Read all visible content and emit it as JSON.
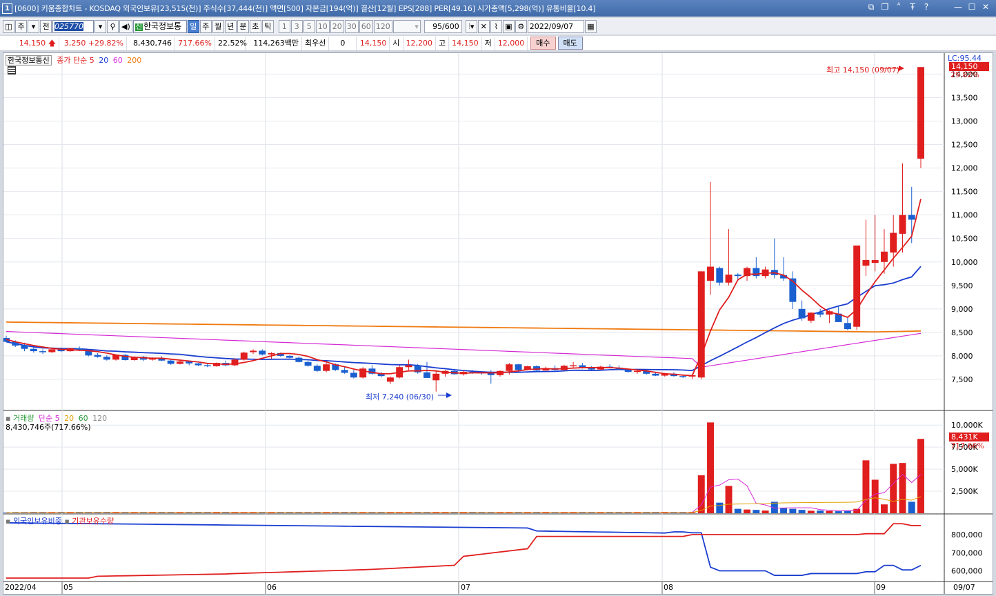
{
  "window": {
    "index": "1",
    "title": "[0600] 키움종합차트 - KOSDAQ 외국인보유[23,515(천)] 주식수[37,444(천)] 액면[500] 자본금[194(억)] 결산[12월] EPS[288] PER[49.16] 시가총액[5,298(억)] 유통비율[10.4]"
  },
  "toolbar": {
    "period_btn": "주",
    "prev_btn": "전",
    "code": "025770",
    "stock_name_badge": "신",
    "stock_name": "한국정보통",
    "periods": [
      "일",
      "주",
      "월",
      "년",
      "분",
      "초",
      "틱"
    ],
    "active_period": "일",
    "intervals": [
      "1",
      "3",
      "5",
      "10",
      "20",
      "30",
      "60",
      "120"
    ],
    "count": "95/600",
    "date": "2022/09/07"
  },
  "pricebar": {
    "price": "14,150",
    "change": "3,250",
    "change_pct": "+29.82%",
    "volume": "8,430,746",
    "vol_ratio": "717.66%",
    "turnover": "22.52%",
    "amount": "114,263백만",
    "pref_label": "최우선",
    "pref_value": "0",
    "best_price": "14,150",
    "open_label": "시",
    "open": "12,200",
    "high_label": "고",
    "high": "14,150",
    "low_label": "저",
    "low": "12,000",
    "buy": "매수",
    "sell": "매도"
  },
  "price_panel": {
    "stock_label": "한국정보통신",
    "ma_label": "종가 단순",
    "ma_periods": [
      "5",
      "20",
      "60",
      "200"
    ],
    "ma_colors": [
      "#e01e1e",
      "#1a3dd0",
      "#d62ad6",
      "#f07a10"
    ],
    "lc_label": "LC:95.44",
    "current_tag": "14,150",
    "current_pct": "29.82%",
    "high_note": "최고 14,150 (09/07)",
    "low_note": "최저 7,240 (06/30)",
    "y_ticks": [
      "14,000",
      "13,500",
      "13,000",
      "12,500",
      "12,000",
      "11,500",
      "11,000",
      "10,500",
      "10,000",
      "9,500",
      "9,000",
      "8,500",
      "8,000",
      "7,500"
    ]
  },
  "volume_panel": {
    "label": "거래량",
    "ma_label": "단순",
    "ma_periods": [
      "5",
      "20",
      "60",
      "120"
    ],
    "ma_colors": [
      "#d62ad6",
      "#e0a000",
      "#2a9a3a",
      "#888888"
    ],
    "info": "8,430,746주(717.66%)",
    "current_tag": "8,431K",
    "current_pct": "717.66%",
    "y_ticks": [
      "10,000K",
      "7,500K",
      "5,000K",
      "2,500K"
    ]
  },
  "holding_panel": {
    "foreign_label": "외국인보유비중",
    "inst_label": "기관보유수량",
    "y_ticks": [
      "800,000",
      "700,000",
      "600,000"
    ]
  },
  "x_axis": {
    "labels": [
      "2022/04",
      "05",
      "06",
      "07",
      "08",
      "09"
    ],
    "end_label": "09/07"
  },
  "chart_data": {
    "type": "candlestick",
    "dates_first": "2022/04",
    "dates_last": "09/07",
    "ylim": [
      7000,
      14300
    ],
    "candles": [
      [
        8380,
        8430,
        8290,
        8300
      ],
      [
        8300,
        8330,
        8190,
        8220
      ],
      [
        8230,
        8280,
        8100,
        8150
      ],
      [
        8150,
        8200,
        8070,
        8100
      ],
      [
        8100,
        8140,
        8040,
        8080
      ],
      [
        8080,
        8160,
        8060,
        8140
      ],
      [
        8150,
        8180,
        8080,
        8100
      ],
      [
        8100,
        8170,
        8090,
        8160
      ],
      [
        8160,
        8200,
        8100,
        8110
      ],
      [
        8120,
        8140,
        7990,
        8010
      ],
      [
        8020,
        8060,
        7960,
        7980
      ],
      [
        7980,
        8010,
        7900,
        7920
      ],
      [
        7920,
        8030,
        7900,
        8020
      ],
      [
        8020,
        8040,
        7900,
        7910
      ],
      [
        7910,
        7990,
        7900,
        7980
      ],
      [
        7980,
        8000,
        7890,
        7920
      ],
      [
        7920,
        7970,
        7900,
        7960
      ],
      [
        7950,
        7990,
        7890,
        7900
      ],
      [
        7900,
        7920,
        7810,
        7830
      ],
      [
        7830,
        7900,
        7820,
        7880
      ],
      [
        7880,
        7900,
        7800,
        7840
      ],
      [
        7840,
        7850,
        7780,
        7800
      ],
      [
        7800,
        7830,
        7760,
        7780
      ],
      [
        7780,
        7860,
        7770,
        7850
      ],
      [
        7850,
        7900,
        7780,
        7800
      ],
      [
        7800,
        7950,
        7780,
        7920
      ],
      [
        7920,
        8090,
        7900,
        8070
      ],
      [
        8080,
        8140,
        8040,
        8110
      ],
      [
        8110,
        8140,
        8010,
        8030
      ],
      [
        8030,
        8080,
        7940,
        8060
      ],
      [
        8060,
        8070,
        7980,
        8000
      ],
      [
        8000,
        8020,
        7950,
        7960
      ],
      [
        7960,
        7990,
        7860,
        7870
      ],
      [
        7870,
        7900,
        7770,
        7790
      ],
      [
        7790,
        7820,
        7660,
        7680
      ],
      [
        7680,
        7850,
        7650,
        7820
      ],
      [
        7820,
        7840,
        7680,
        7700
      ],
      [
        7700,
        7760,
        7620,
        7640
      ],
      [
        7640,
        7700,
        7520,
        7540
      ],
      [
        7540,
        7760,
        7520,
        7730
      ],
      [
        7730,
        7800,
        7600,
        7620
      ],
      [
        7620,
        7660,
        7540,
        7570
      ],
      [
        7450,
        7560,
        7400,
        7540
      ],
      [
        7540,
        7800,
        7520,
        7760
      ],
      [
        7760,
        7920,
        7700,
        7800
      ],
      [
        7800,
        7830,
        7620,
        7650
      ],
      [
        7650,
        7870,
        7620,
        7530
      ],
      [
        7480,
        7680,
        7240,
        7620
      ],
      [
        7620,
        7700,
        7560,
        7680
      ],
      [
        7680,
        7720,
        7600,
        7610
      ],
      [
        7610,
        7690,
        7580,
        7660
      ],
      [
        7660,
        7700,
        7620,
        7650
      ],
      [
        7650,
        7660,
        7600,
        7630
      ],
      [
        7640,
        7700,
        7410,
        7590
      ],
      [
        7590,
        7690,
        7560,
        7680
      ],
      [
        7680,
        7850,
        7600,
        7820
      ],
      [
        7820,
        7830,
        7650,
        7700
      ],
      [
        7700,
        7790,
        7690,
        7780
      ],
      [
        7780,
        7800,
        7660,
        7690
      ],
      [
        7690,
        7770,
        7680,
        7740
      ],
      [
        7740,
        7800,
        7680,
        7700
      ],
      [
        7700,
        7810,
        7690,
        7790
      ],
      [
        7790,
        7870,
        7740,
        7800
      ],
      [
        7800,
        7850,
        7730,
        7740
      ],
      [
        7740,
        7780,
        7690,
        7710
      ],
      [
        7710,
        7790,
        7700,
        7770
      ],
      [
        7770,
        7820,
        7730,
        7750
      ],
      [
        7750,
        7800,
        7700,
        7710
      ],
      [
        7710,
        7720,
        7640,
        7660
      ],
      [
        7660,
        7700,
        7620,
        7680
      ],
      [
        7680,
        7700,
        7600,
        7620
      ],
      [
        7620,
        7640,
        7570,
        7580
      ],
      [
        7580,
        7640,
        7560,
        7620
      ],
      [
        7620,
        7650,
        7560,
        7570
      ],
      [
        7570,
        7600,
        7530,
        7560
      ],
      [
        7560,
        7600,
        7510,
        7590
      ],
      [
        7540,
        9800,
        7500,
        9800
      ],
      [
        9600,
        11700,
        9300,
        9900
      ],
      [
        9870,
        9900,
        9500,
        9560
      ],
      [
        9560,
        10700,
        9500,
        9730
      ],
      [
        9730,
        9760,
        9600,
        9700
      ],
      [
        9700,
        9900,
        9600,
        9870
      ],
      [
        9870,
        10100,
        9650,
        9700
      ],
      [
        9700,
        9900,
        9650,
        9840
      ],
      [
        9830,
        10500,
        9650,
        9720
      ],
      [
        9720,
        10100,
        9600,
        9650
      ],
      [
        9650,
        9800,
        9000,
        9150
      ],
      [
        9000,
        9180,
        8750,
        8800
      ],
      [
        8750,
        8930,
        8700,
        8920
      ],
      [
        8930,
        9000,
        8820,
        8880
      ],
      [
        8880,
        8970,
        8700,
        8950
      ],
      [
        8900,
        9060,
        8720,
        8720
      ],
      [
        8700,
        8840,
        8550,
        8570
      ],
      [
        8620,
        10350,
        8550,
        10350
      ],
      [
        9920,
        10900,
        9700,
        10040
      ],
      [
        9980,
        11000,
        9800,
        10040
      ],
      [
        10000,
        10700,
        9750,
        10220
      ],
      [
        10200,
        11000,
        9900,
        10620
      ],
      [
        10600,
        12100,
        10200,
        11000
      ],
      [
        11000,
        11600,
        10400,
        10900
      ],
      [
        12200,
        14150,
        12000,
        14150
      ]
    ],
    "ma5": [
      8350,
      8300,
      8260,
      8220,
      8190,
      8160,
      8140,
      8130,
      8120,
      8110,
      8090,
      8060,
      8020,
      7990,
      7970,
      7960,
      7950,
      7950,
      7930,
      7910,
      7890,
      7870,
      7840,
      7830,
      7820,
      7830,
      7860,
      7900,
      7950,
      8000,
      8050,
      8050,
      8030,
      7990,
      7920,
      7870,
      7810,
      7770,
      7720,
      7680,
      7650,
      7620,
      7620,
      7650,
      7680,
      7680,
      7690,
      7680,
      7650,
      7640,
      7630,
      7640,
      7640,
      7640,
      7640,
      7660,
      7680,
      7710,
      7720,
      7730,
      7720,
      7730,
      7740,
      7750,
      7750,
      7750,
      7750,
      7740,
      7720,
      7700,
      7680,
      7650,
      7620,
      7610,
      7590,
      7580,
      8010,
      8530,
      8980,
      9250,
      9620,
      9740,
      9740,
      9760,
      9770,
      9720,
      9590,
      9400,
      9240,
      9060,
      8930,
      8890,
      8820,
      8990,
      9300,
      9580,
      9830,
      10080,
      10310,
      10550,
      11340
    ]
  }
}
